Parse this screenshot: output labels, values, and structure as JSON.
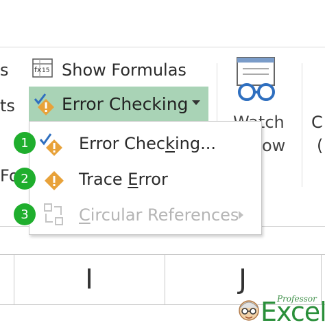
{
  "ribbon": {
    "partial_left_top": "s",
    "partial_left_mid": "ts",
    "partial_left_low": "Fo",
    "show_formulas_label": "Show Formulas",
    "error_checking_label": "Error Checking",
    "watch_label_line1": "Watch",
    "watch_label_line2": "ow",
    "partial_right_c": "C",
    "partial_right_paren": "("
  },
  "dropdown": {
    "items": [
      {
        "badge": "1",
        "label_before": "Error Chec",
        "label_accel": "k",
        "label_after": "ing...",
        "enabled": true
      },
      {
        "badge": "2",
        "label_before": "Trace ",
        "label_accel": "E",
        "label_after": "rror",
        "enabled": true
      },
      {
        "badge": "3",
        "label_before": "",
        "label_accel": "C",
        "label_after": "ircular References",
        "enabled": false
      }
    ]
  },
  "grid": {
    "columns": [
      "I",
      "J"
    ]
  },
  "logo": {
    "small_text": "Professor",
    "big_text": "Excel"
  },
  "colors": {
    "accent_green": "#a9d3b6",
    "badge_green": "#1fae2d",
    "check_blue": "#2f6fbf",
    "warn_orange": "#e8a23a",
    "disabled_gray": "#b5b5b5"
  }
}
